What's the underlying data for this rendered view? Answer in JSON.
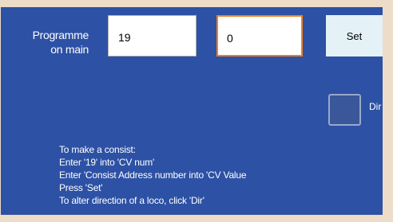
{
  "programme": {
    "label_line1": "Programme",
    "label_line2": "on main",
    "cv_number_value": "19",
    "cv_value_value": "0",
    "set_label": "Set"
  },
  "direction": {
    "label": "Dir",
    "checked": false
  },
  "instructions": [
    "To make a consist:",
    "Enter '19' into 'CV num'",
    "Enter 'Consist Address number into 'CV Value",
    "Press 'Set'",
    "To alter direction of a loco, click 'Dir'"
  ],
  "colors": {
    "page_background": "#ecdcc8",
    "panel_background": "#2d51a4",
    "active_field_border": "#f08020",
    "set_button_background": "#e4f1f6"
  }
}
